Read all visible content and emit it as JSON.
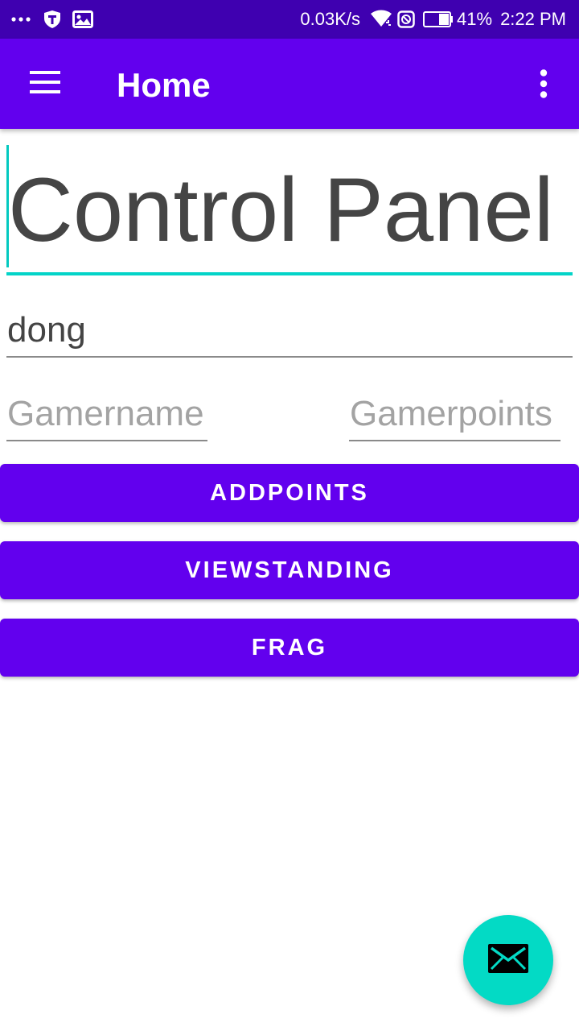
{
  "status_bar": {
    "network_speed": "0.03K/s",
    "battery_percent": "41%",
    "time": "2:22 PM",
    "icons": [
      "more-dots-icon",
      "shield-icon",
      "image-icon",
      "wifi-icon",
      "do-not-disturb-icon",
      "battery-icon"
    ]
  },
  "app_bar": {
    "title": "Home",
    "menu_icon": "hamburger-menu-icon",
    "overflow_icon": "more-vert-icon"
  },
  "content": {
    "title_field_value": "Control Panel",
    "name_field_value": "dong",
    "gamername_placeholder": "Gamername",
    "gamerpoints_placeholder": "Gamerpoints"
  },
  "buttons": {
    "addpoints": "ADDPOINTS",
    "viewstanding": "VIEWSTANDING",
    "frag": "FRAG"
  },
  "fab": {
    "icon": "email-icon"
  },
  "colors": {
    "status_bar": "#3f00b0",
    "primary": "#6200ee",
    "accent": "#03dac5",
    "text": "#444444",
    "hint": "#a3a3a3"
  }
}
